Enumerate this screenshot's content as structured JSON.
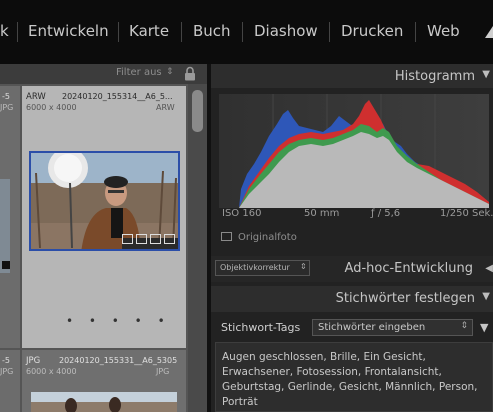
{
  "modules": [
    "k",
    "Entwickeln",
    "Karte",
    "Buch",
    "Diashow",
    "Drucken",
    "Web"
  ],
  "grid": {
    "filter_label": "Filter aus",
    "cells": [
      {
        "info1": "-5",
        "info2": "JPG"
      },
      {
        "format": "ARW",
        "filename": "20240120_155314__A6_5...",
        "size": "6000 x 4000",
        "badge": "ARW"
      },
      {
        "info1": "-5",
        "info2": "JPG"
      },
      {
        "format": "JPG",
        "filename": "20240120_155331__A6_5305",
        "size": "6000 x 4000",
        "badge": "JPG"
      }
    ],
    "dots": "• • • • •"
  },
  "histogram": {
    "title": "Histogramm",
    "iso": "ISO 160",
    "focal": "50 mm",
    "aperture": "ƒ / 5,6",
    "shutter": "1/250 Sek.",
    "original_photo_label": "Originalfoto",
    "colors": {
      "gray": "#b9b9b9",
      "blue": "#2e57b8",
      "green": "#3f9a4e",
      "red": "#cf2f2f"
    }
  },
  "adhoc": {
    "title": "Ad-hoc-Entwicklung",
    "select_value": "Objektivkorrektur"
  },
  "keywords": {
    "title": "Stichwörter festlegen",
    "tags_label": "Stichwort-Tags",
    "select_value": "Stichwörter eingeben",
    "text": "Augen geschlossen, Brille, Ein Gesicht, Erwachsener, Fotosession, Frontalansicht, Geburtstag, Gerlinde, Gesicht, Männlich, Person, Porträt"
  },
  "icons": [
    "lock-icon",
    "triangle-icon",
    "chevron-updown-icon"
  ]
}
